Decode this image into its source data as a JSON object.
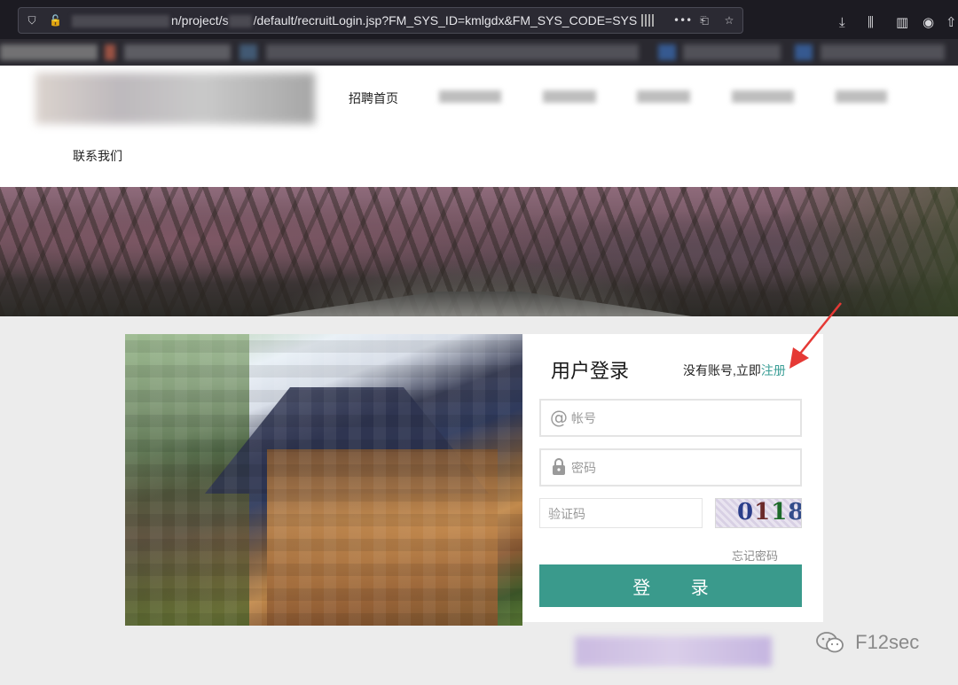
{
  "browser": {
    "url_prefix": "n/project/s",
    "url_main": "/default/recruitLogin.jsp?FM_SYS_ID=kmlgdx&FM_SYS_CODE=SYS"
  },
  "nav": {
    "home": "招聘首页",
    "contact": "联系我们"
  },
  "login": {
    "title": "用户登录",
    "no_account": "没有账号,立即",
    "register": "注册",
    "account_placeholder": "帐号",
    "password_placeholder": "密码",
    "captcha_placeholder": "验证码",
    "captcha_digits": [
      "0",
      "1",
      "1",
      "8"
    ],
    "forgot": "忘记密码",
    "submit": "登 录"
  },
  "watermark": {
    "text": "F12sec"
  },
  "colors": {
    "accent": "#3a9a8c",
    "link": "#3c9f97",
    "arrow": "#e53935"
  }
}
